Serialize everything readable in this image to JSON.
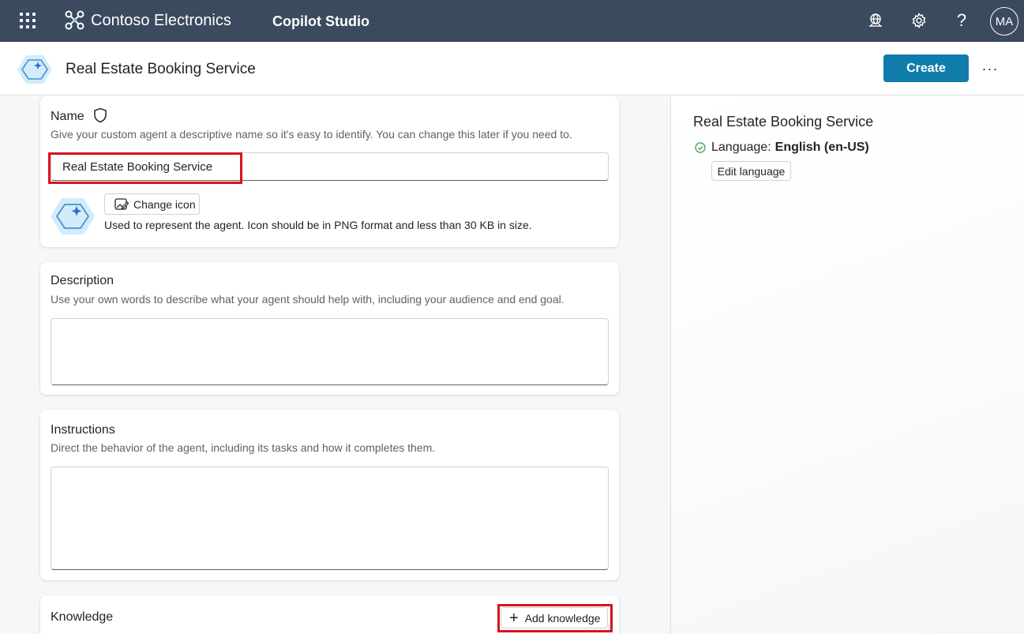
{
  "topbar": {
    "app_launcher_icon": "waffle-icon",
    "org_name": "Contoso Electronics",
    "product_name": "Copilot Studio",
    "icons": [
      "environment-globe-icon",
      "gear-icon",
      "help-icon"
    ],
    "avatar_initials": "MA"
  },
  "header": {
    "agent_name": "Real Estate Booking Service",
    "create_label": "Create",
    "more_label": "···"
  },
  "form": {
    "name": {
      "title": "Name",
      "description": "Give your custom agent a descriptive name so it's easy to identify. You can change this later if you need to.",
      "value": "Real Estate Booking Service",
      "change_icon_label": "Change icon",
      "icon_help": "Used to represent the agent. Icon should be in PNG format and less than 30 KB in size."
    },
    "description": {
      "title": "Description",
      "hint": "Use your own words to describe what your agent should help with, including your audience and end goal.",
      "value": ""
    },
    "instructions": {
      "title": "Instructions",
      "hint": "Direct the behavior of the agent, including its tasks and how it completes them.",
      "value": ""
    },
    "knowledge": {
      "title": "Knowledge",
      "add_label": "Add knowledge"
    }
  },
  "summary": {
    "agent_name": "Real Estate Booking Service",
    "language_label": "Language:",
    "language_value": "English (en-US)",
    "edit_language_label": "Edit language"
  },
  "colors": {
    "topbar": "#3b4a5f",
    "primary_button": "#0f7cac",
    "highlight_box": "#d9131f"
  }
}
